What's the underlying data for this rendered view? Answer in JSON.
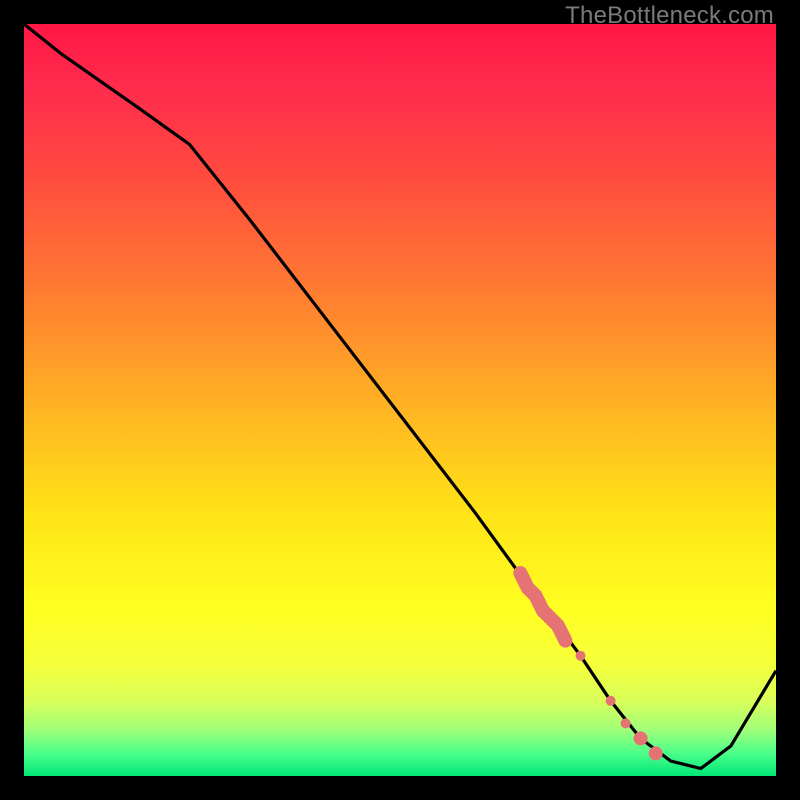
{
  "watermark": "TheBottleneck.com",
  "colors": {
    "background": "#000000",
    "gradient_top": "#ff1744",
    "gradient_mid": "#ffe317",
    "gradient_bottom": "#00e676",
    "curve": "#000000",
    "markers": "#e57373"
  },
  "chart_data": {
    "type": "line",
    "title": "",
    "xlabel": "",
    "ylabel": "",
    "xlim": [
      0,
      100
    ],
    "ylim": [
      0,
      100
    ],
    "grid": false,
    "series": [
      {
        "name": "bottleneck-curve",
        "x": [
          0,
          5,
          15,
          22,
          30,
          40,
          50,
          60,
          68,
          74,
          78,
          82,
          86,
          90,
          94,
          100
        ],
        "values": [
          100,
          96,
          89,
          84,
          74,
          61,
          48,
          35,
          24,
          16,
          10,
          5,
          2,
          1,
          4,
          14
        ]
      }
    ],
    "markers": {
      "name": "highlight-cluster",
      "x": [
        66,
        67,
        68,
        69,
        70,
        71,
        72,
        74,
        78,
        80,
        82,
        84
      ],
      "values": [
        27,
        25,
        24,
        22,
        21,
        20,
        18,
        16,
        10,
        7,
        5,
        3
      ]
    }
  }
}
